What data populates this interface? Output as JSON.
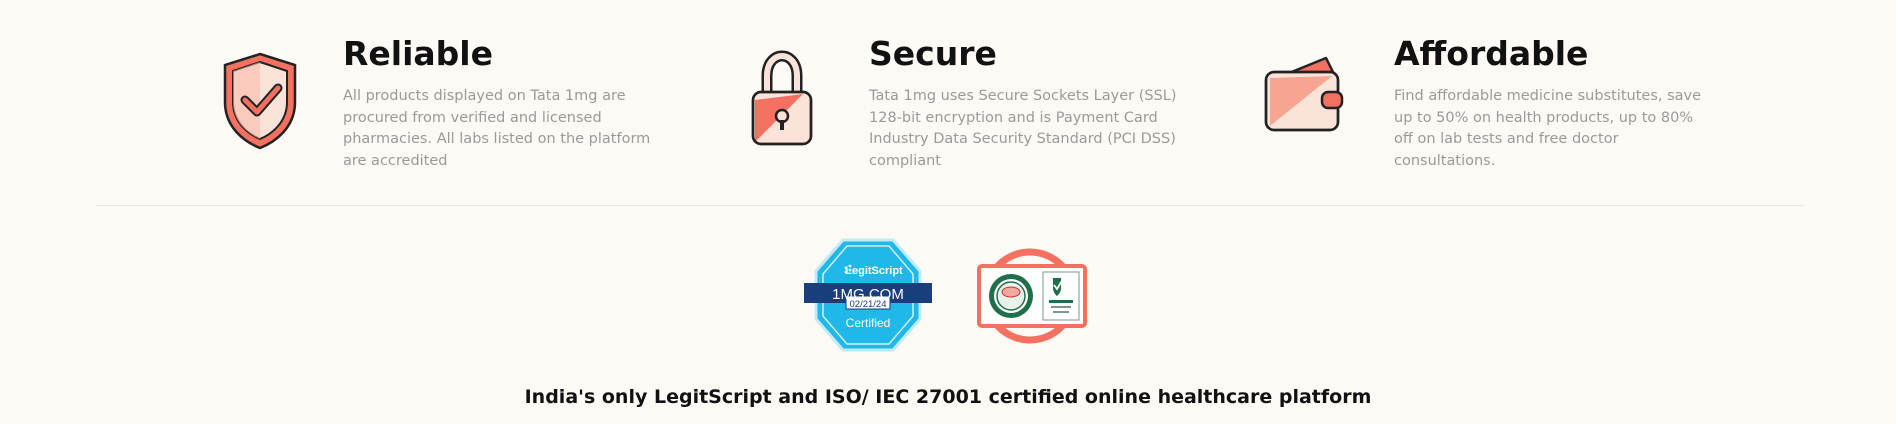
{
  "features": [
    {
      "icon": "shield-check-icon",
      "title": "Reliable",
      "description": "All products displayed on Tata 1mg are procured from verified and licensed pharmacies. All labs listed on the platform are accredited"
    },
    {
      "icon": "padlock-icon",
      "title": "Secure",
      "description": "Tata 1mg uses Secure Sockets Layer (SSL) 128-bit encryption and is Payment Card Industry Data Security Standard (PCI DSS) compliant"
    },
    {
      "icon": "wallet-icon",
      "title": "Affordable",
      "description": "Find affordable medicine substitutes, save up to 50% on health products, up to 80% off on lab tests and free doctor consultations."
    }
  ],
  "badges": {
    "legitscript": {
      "brand": "LegitScript",
      "site": "1MG.COM",
      "date": "02/21/24",
      "status": "Certified"
    },
    "iso": {
      "name": "ISO/IEC 27001 certification seal"
    }
  },
  "tagline": "India's only LegitScript and ISO/ IEC 27001 certified online healthcare platform",
  "colors": {
    "accent": "#f47060",
    "accent_light": "#fce3d9",
    "legit_blue": "#1fb8e8",
    "legit_navy": "#1a3d7c",
    "text_muted": "#9a9a9a"
  }
}
